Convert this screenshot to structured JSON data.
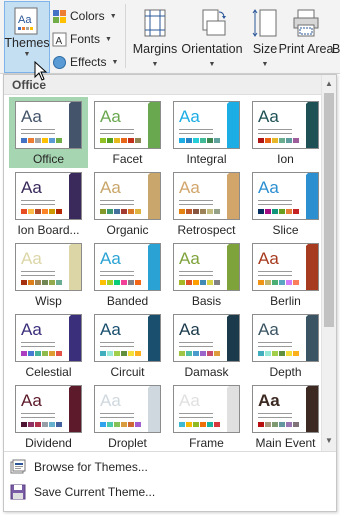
{
  "ribbon": {
    "themes_label": "Themes",
    "colors_label": "Colors",
    "fonts_label": "Fonts",
    "effects_label": "Effects",
    "margins_label": "Margins",
    "orientation_label": "Orientation",
    "size_label": "Size",
    "print_area_label": "Print Area",
    "partial_label": "B"
  },
  "gallery": {
    "section_title": "Office",
    "themes": [
      {
        "name": "Office",
        "accent": "#44546a",
        "swatches": [
          "#4472c4",
          "#ed7d31",
          "#a5a5a5",
          "#ffc000",
          "#5b9bd5",
          "#70ad47"
        ],
        "selected": true
      },
      {
        "name": "Facet",
        "accent": "#6aa84f",
        "swatches": [
          "#90c226",
          "#54a021",
          "#e6b91e",
          "#e76618",
          "#c42f1a",
          "#918655"
        ]
      },
      {
        "name": "Integral",
        "accent": "#1cade4",
        "swatches": [
          "#1cade4",
          "#2683c6",
          "#27ced7",
          "#42ba97",
          "#3e8853",
          "#62a39f"
        ]
      },
      {
        "name": "Ion",
        "accent": "#1e5155",
        "swatches": [
          "#b01513",
          "#ea6312",
          "#e6b729",
          "#6aac90",
          "#5f9c9d",
          "#9e5e9b"
        ]
      },
      {
        "name": "Ion Board...",
        "accent": "#3a2a5c",
        "swatches": [
          "#e84c22",
          "#ffbd47",
          "#b64926",
          "#ff8427",
          "#cc9900",
          "#b22600"
        ]
      },
      {
        "name": "Organic",
        "accent": "#c9a66b",
        "swatches": [
          "#83992a",
          "#3c9770",
          "#44709d",
          "#a23c33",
          "#d97828",
          "#deb340"
        ]
      },
      {
        "name": "Retrospect",
        "accent": "#d2a56b",
        "swatches": [
          "#e48312",
          "#bd582c",
          "#865640",
          "#9b8357",
          "#c2bc80",
          "#94a088"
        ]
      },
      {
        "name": "Slice",
        "accent": "#2b8fd0",
        "swatches": [
          "#052f61",
          "#a50e82",
          "#14967c",
          "#6a9e1f",
          "#e87d37",
          "#c62324"
        ]
      },
      {
        "name": "Wisp",
        "accent": "#dcd6a7",
        "swatches": [
          "#a53010",
          "#de7e18",
          "#9f8351",
          "#728653",
          "#92aa4c",
          "#6aac91"
        ]
      },
      {
        "name": "Banded",
        "accent": "#2aa3d4",
        "swatches": [
          "#ffc000",
          "#a5d028",
          "#08cc78",
          "#f24099",
          "#828288",
          "#f56617"
        ]
      },
      {
        "name": "Basis",
        "accent": "#7ea33b",
        "swatches": [
          "#a6b727",
          "#df5327",
          "#fe9e00",
          "#418ab3",
          "#d7d447",
          "#818183"
        ]
      },
      {
        "name": "Berlin",
        "accent": "#a63b1f",
        "swatches": [
          "#f09415",
          "#c1b56b",
          "#4baf73",
          "#5aa6c0",
          "#d17df9",
          "#fa7e5c"
        ]
      },
      {
        "name": "Celestial",
        "accent": "#3a2f7a",
        "swatches": [
          "#ac3ec1",
          "#477bd1",
          "#46b298",
          "#90ba4c",
          "#dd9d31",
          "#e25247"
        ]
      },
      {
        "name": "Circuit",
        "accent": "#1a4f6e",
        "swatches": [
          "#41aebd",
          "#97e9d5",
          "#a2cf49",
          "#608f3d",
          "#f4de3a",
          "#fcb11c"
        ]
      },
      {
        "name": "Damask",
        "accent": "#1b3a4b",
        "swatches": [
          "#9ec544",
          "#50bea3",
          "#4a9ccc",
          "#9a66ca",
          "#c54f71",
          "#de9c3c"
        ]
      },
      {
        "name": "Depth",
        "accent": "#3a5463",
        "swatches": [
          "#41aebd",
          "#97e9d5",
          "#a2cf49",
          "#608f3d",
          "#f4de3a",
          "#fcb11c"
        ]
      },
      {
        "name": "Dividend",
        "accent": "#5c1a2a",
        "swatches": [
          "#4d1434",
          "#903163",
          "#b2324b",
          "#969fa7",
          "#66b1ce",
          "#40619d"
        ]
      },
      {
        "name": "Droplet",
        "accent": "#cfd8de",
        "swatches": [
          "#2fa3ee",
          "#4bcaad",
          "#86c157",
          "#d99c3f",
          "#ce6633",
          "#a35dd1"
        ]
      },
      {
        "name": "Frame",
        "accent": "#e0e0e0",
        "swatches": [
          "#40bad2",
          "#fab900",
          "#90bb23",
          "#ee7008",
          "#1ab39f",
          "#d5393d"
        ]
      },
      {
        "name": "Main Event",
        "accent": "#3c2a22",
        "swatches": [
          "#b80e0f",
          "#a6987d",
          "#7f9a71",
          "#64969f",
          "#9b75b2",
          "#80737a"
        ]
      }
    ]
  },
  "menu": {
    "browse_label": "Browse for Themes...",
    "save_label": "Save Current Theme..."
  }
}
